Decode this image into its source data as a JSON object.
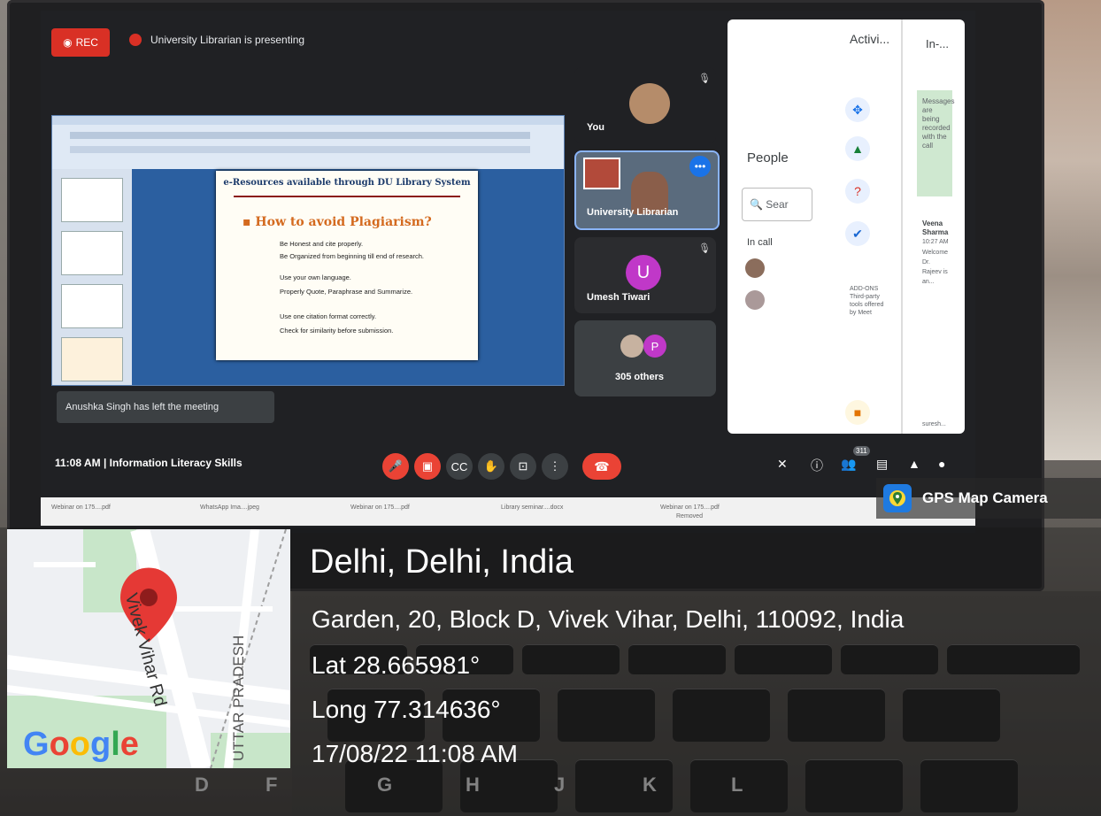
{
  "meet": {
    "rec_label": "REC",
    "presenting_text": "University Librarian is presenting",
    "slide": {
      "title": "e-Resources available through DU Library System",
      "heading": "How to avoid Plagiarism?",
      "bullets": [
        "Be Honest and cite properly.",
        "Be Organized from beginning till end of research.",
        "Use your own language.",
        "Properly Quote, Paraphrase and Summarize.",
        "Use one citation format correctly.",
        "Check for similarity before submission."
      ]
    },
    "tiles": {
      "you_label": "You",
      "librarian_label": "University Librarian",
      "umesh_label": "Umesh Tiwari",
      "umesh_initial": "U",
      "others_label": "305 others",
      "others_initial": "P"
    },
    "toast": "Anushka Singh has left the meeting",
    "time": "11:08 AM",
    "separator": "|",
    "meeting_name": "Information Literacy Skills",
    "participant_badge": "311",
    "panel": {
      "activities_title": "Activi...",
      "chat_title": "In-...",
      "people_label": "People",
      "search_placeholder": "Sear",
      "in_call_label": "In call",
      "addons_text": "ADD-ONS Third-party tools offered by Meet",
      "chat_notice": "Messages are being recorded with the call",
      "chat_user": "Veena Sharma",
      "chat_time": "10:27 AM",
      "chat_body": "Welcome Dr. Rajeev is an...",
      "chat_footer": "suresh..."
    }
  },
  "taskbar": {
    "items": [
      "Webinar on 175....pdf",
      "WhatsApp Ima....jpeg",
      "Webinar on 175....pdf",
      "Library seminar....docx",
      "Webinar on 175....pdf"
    ],
    "sub_label": "Removed"
  },
  "gps": {
    "app_label": "GPS Map Camera",
    "city": "Delhi, Delhi, India",
    "address": "Garden, 20, Block D, Vivek Vihar, Delhi, 110092, India",
    "lat": "Lat 28.665981°",
    "long": "Long 77.314636°",
    "datetime": "17/08/22 11:08 AM",
    "map": {
      "road_label": "Vivek Vihar Rd",
      "region_label": "UTTAR PRADESH",
      "brand": "Google"
    }
  },
  "keyboard": {
    "keys": [
      "G",
      "H",
      "J",
      "K",
      "L",
      "D",
      "F"
    ]
  },
  "colors": {
    "meet_red": "#d93025",
    "meet_bg": "#202124",
    "tile_bg": "#3c4043",
    "pin_red": "#e53935"
  }
}
